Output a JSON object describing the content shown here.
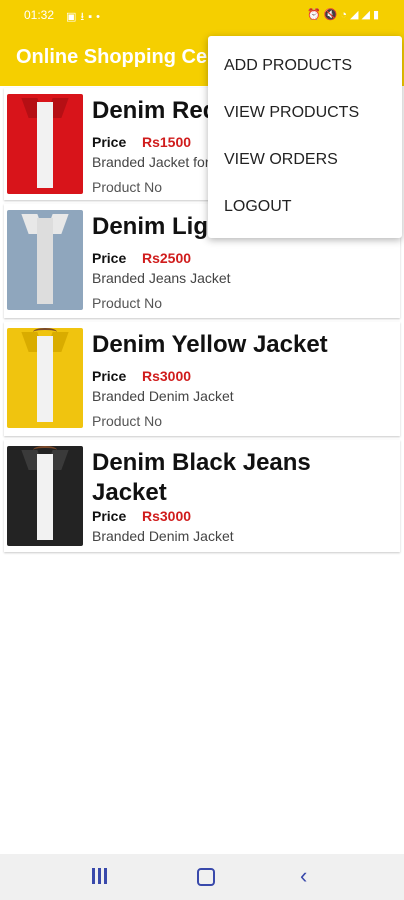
{
  "status_bar": {
    "time": "01:32",
    "left_icons": [
      "image-icon",
      "download-icon",
      "message-icon",
      "dot-icon"
    ],
    "right_icons": [
      "alarm-icon",
      "mute-icon",
      "wifi-icon",
      "signal-icon",
      "signal-icon",
      "battery-icon"
    ]
  },
  "app_bar": {
    "title": "Online Shopping Ce",
    "background": "#f5cf00"
  },
  "overflow_menu": {
    "items": [
      {
        "label": "ADD PRODUCTS"
      },
      {
        "label": "VIEW PRODUCTS"
      },
      {
        "label": "VIEW ORDERS"
      },
      {
        "label": "LOGOUT"
      }
    ]
  },
  "products": [
    {
      "name": "Denim Red Jacket",
      "price_label": "Price",
      "price": "Rs1500",
      "description": "Branded Jacket for Men",
      "product_no_label": "Product No",
      "image_color": "#d8141a"
    },
    {
      "name": "Denim Light Blue Jeans",
      "price_label": "Price",
      "price": "Rs2500",
      "description": "Branded Jeans Jacket",
      "product_no_label": "Product No",
      "image_color": "#8fa6bd"
    },
    {
      "name": "Denim Yellow Jacket",
      "price_label": "Price",
      "price": "Rs3000",
      "description": "Branded Denim Jacket",
      "product_no_label": "Product No",
      "image_color": "#f0c40f"
    },
    {
      "name": "Denim Black Jeans Jacket",
      "price_label": "Price",
      "price": "Rs3000",
      "description": "Branded Denim Jacket",
      "image_color": "#232323"
    }
  ],
  "nav_bar": {
    "buttons": [
      "recent-apps-icon",
      "home-icon",
      "back-icon"
    ]
  },
  "colors": {
    "accent": "#f5cf00",
    "price": "#d01c1c",
    "nav_icons": "#3949ab"
  }
}
